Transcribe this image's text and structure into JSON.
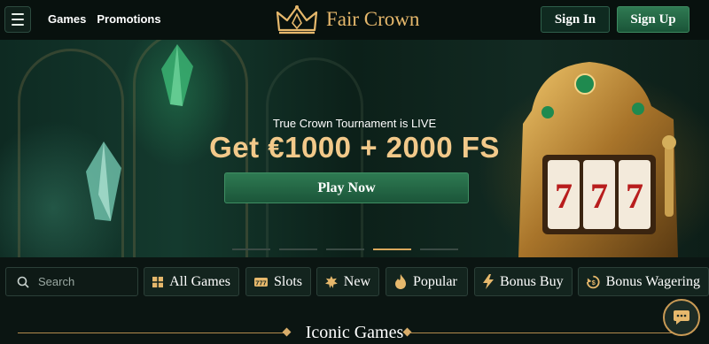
{
  "header": {
    "nav": [
      "Games",
      "Promotions"
    ],
    "logo_text": "Fair Crown",
    "signin_label": "Sign In",
    "signup_label": "Sign Up"
  },
  "hero": {
    "subtitle": "True Crown Tournament is LIVE",
    "title": "Get €1000 + 2000 FS",
    "cta_label": "Play Now",
    "slides_total": 5,
    "active_slide": 4
  },
  "search": {
    "label": "Search"
  },
  "categories": [
    {
      "label": "All Games",
      "icon": "grid-icon"
    },
    {
      "label": "Slots",
      "icon": "slot-777-icon"
    },
    {
      "label": "New",
      "icon": "new-badge-icon"
    },
    {
      "label": "Popular",
      "icon": "flame-icon"
    },
    {
      "label": "Bonus Buy",
      "icon": "lightning-icon"
    },
    {
      "label": "Bonus Wagering",
      "icon": "wagering-icon"
    }
  ],
  "section": {
    "title": "Iconic Games"
  },
  "colors": {
    "gold": "#e6b86c",
    "green": "#2e7a52",
    "background": "#0b1512"
  }
}
